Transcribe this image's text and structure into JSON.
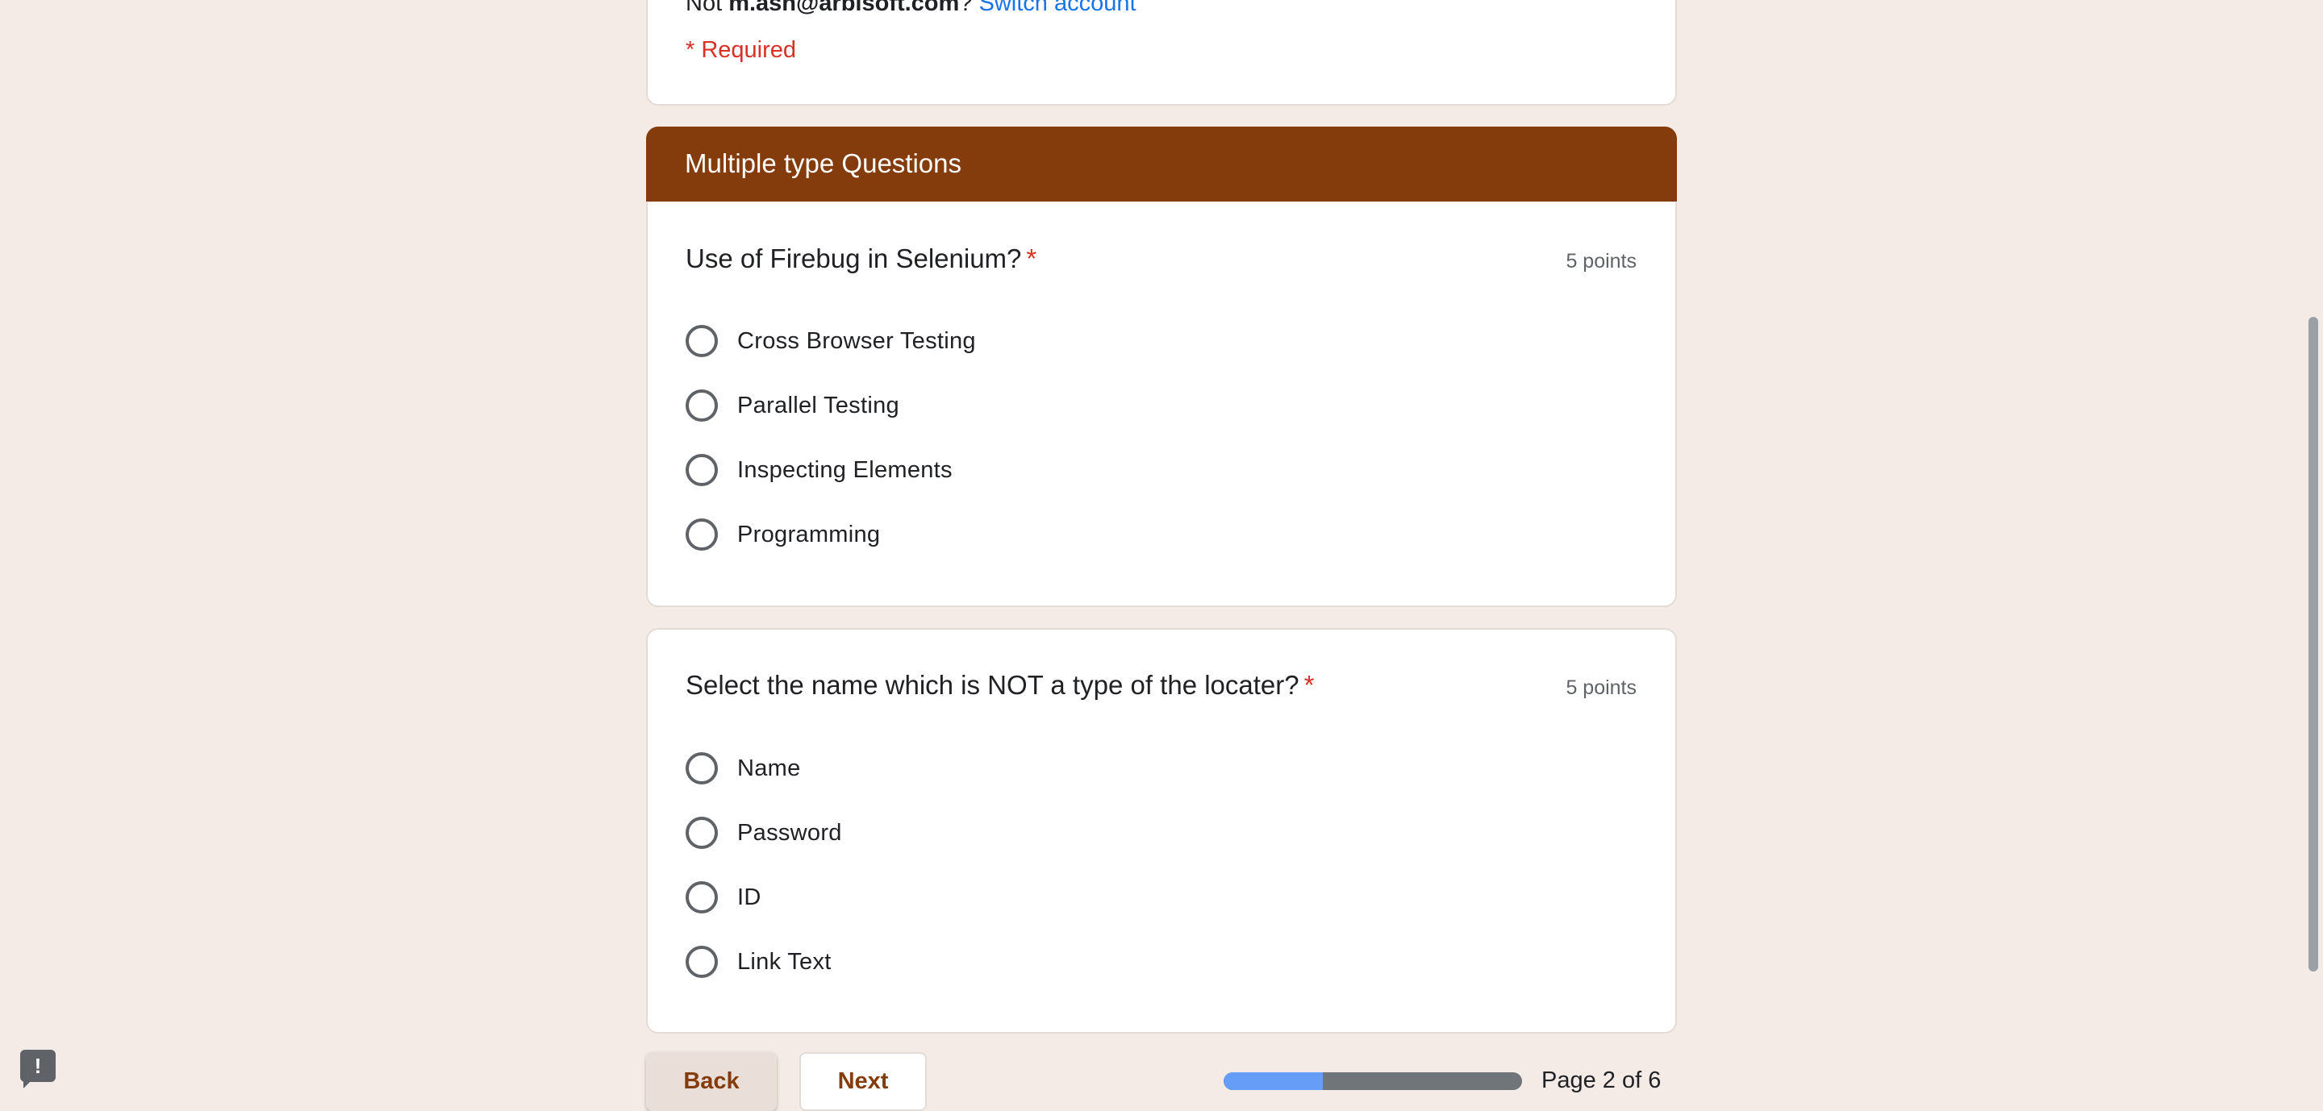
{
  "header": {
    "account_prefix": "Not ",
    "account_email": "m.ash@arbisoft.com",
    "account_suffix": "? ",
    "switch_account": "Switch account",
    "required_note": "* Required"
  },
  "section": {
    "title": "Multiple type Questions"
  },
  "questions": [
    {
      "title": "Use of Firebug in Selenium?",
      "required_mark": "*",
      "points": "5 points",
      "options": [
        "Cross Browser Testing",
        "Parallel Testing",
        "Inspecting Elements",
        "Programming"
      ]
    },
    {
      "title": "Select the name which is NOT a type of the locater?",
      "required_mark": "*",
      "points": "5 points",
      "options": [
        "Name",
        "Password",
        "ID",
        "Link Text"
      ]
    }
  ],
  "navigation": {
    "back_label": "Back",
    "next_label": "Next",
    "page_label": "Page 2 of 6",
    "progress_fraction": 0.333
  },
  "icons": {
    "feedback": "report-feedback-icon",
    "feedback_glyph": "!"
  },
  "colors": {
    "accent": "#843c0c",
    "required": "#d93025",
    "link": "#1a73e8",
    "background": "#f4ebe6",
    "progress_fill": "#669df6"
  }
}
